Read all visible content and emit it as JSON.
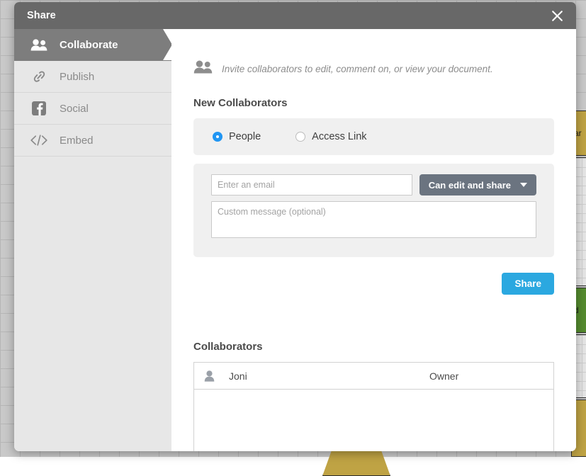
{
  "dialog": {
    "title": "Share",
    "close_icon": "close-icon"
  },
  "sidebar": {
    "items": [
      {
        "label": "Collaborate",
        "icon": "people-icon",
        "active": true
      },
      {
        "label": "Publish",
        "icon": "link-icon",
        "active": false
      },
      {
        "label": "Social",
        "icon": "facebook-icon",
        "active": false
      },
      {
        "label": "Embed",
        "icon": "code-icon",
        "active": false
      }
    ]
  },
  "content": {
    "invite_text": "Invite collaborators to edit, comment on, or view your document.",
    "invite_icon": "people-icon",
    "new_collaborators_heading": "New Collaborators",
    "audience": {
      "options": [
        {
          "label": "People",
          "selected": true
        },
        {
          "label": "Access Link",
          "selected": false
        }
      ]
    },
    "form": {
      "email_placeholder": "Enter an email",
      "email_value": "",
      "permission_label": "Can edit and share",
      "permission_caret": "chevron-down-icon",
      "message_placeholder": "Custom message (optional)",
      "message_value": "",
      "share_label": "Share"
    },
    "collaborators_heading": "Collaborators",
    "collaborators": [
      {
        "name": "Joni",
        "role": "Owner",
        "avatar": "person-icon"
      }
    ]
  },
  "colors": {
    "titlebar": "#686868",
    "sidebar_active": "#7d7d7d",
    "accent_blue": "#2ba8e0",
    "radio_blue": "#2196f3",
    "permission_gray": "#6b7480"
  },
  "background": {
    "nodes": [
      {
        "text": "ar",
        "color": "gold"
      },
      {
        "text": "",
        "color": "grey"
      },
      {
        "text": "d",
        "color": "green"
      },
      {
        "text": "",
        "color": "grey"
      },
      {
        "text": "",
        "color": "gold"
      }
    ]
  }
}
